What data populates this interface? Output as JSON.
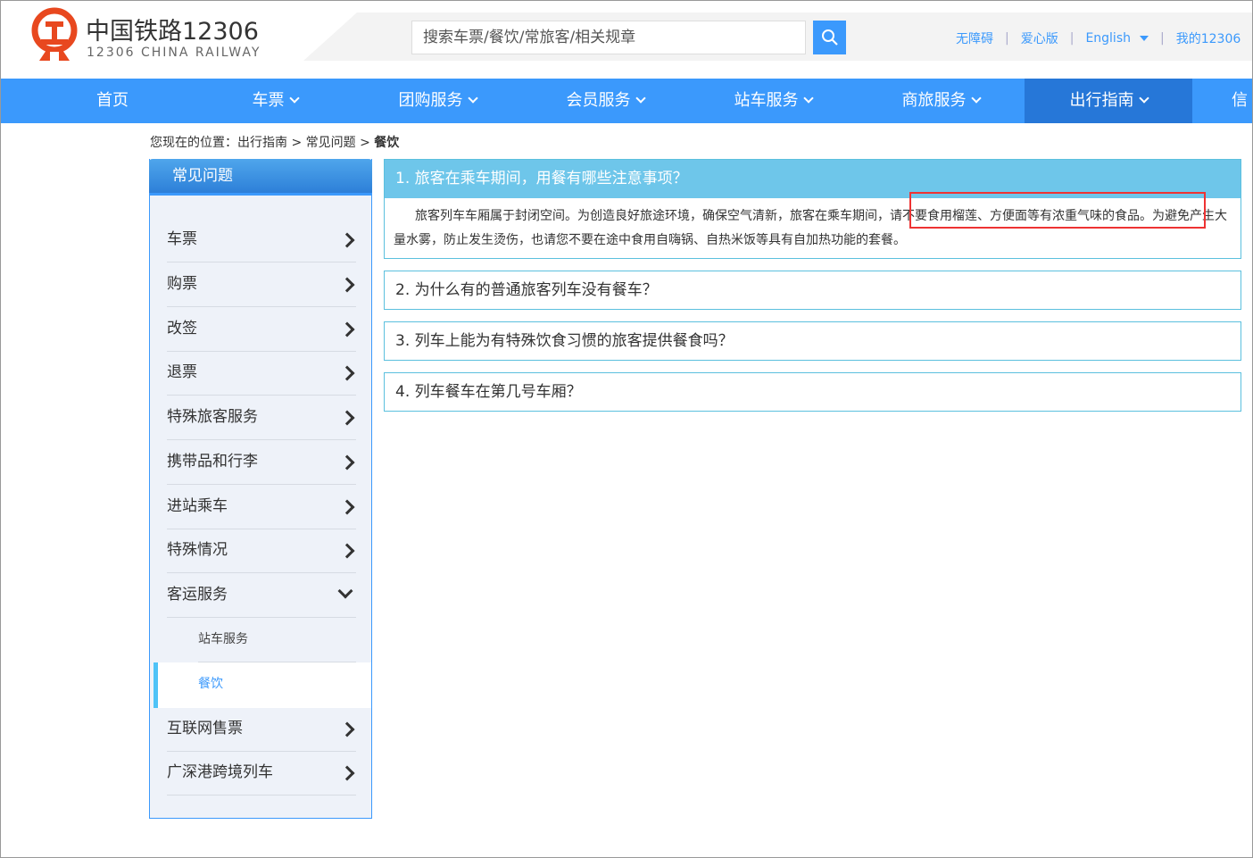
{
  "header": {
    "brand_cn": "中国铁路12306",
    "brand_en": "12306 CHINA RAILWAY",
    "search_placeholder": "搜索车票/餐饮/常旅客/相关规章",
    "logo_icon": "railway-logo-icon",
    "links": [
      "无障碍",
      "爱心版",
      "English",
      "我的12306"
    ]
  },
  "nav": {
    "items": [
      {
        "label": "首页"
      },
      {
        "label": "车票"
      },
      {
        "label": "团购服务"
      },
      {
        "label": "会员服务"
      },
      {
        "label": "站车服务"
      },
      {
        "label": "商旅服务"
      },
      {
        "label": "出行指南"
      },
      {
        "label": "信"
      }
    ],
    "active": "出行指南"
  },
  "breadcrumb": {
    "prefix": "您现在的位置：出行指南 > 常见问题 > ",
    "current": "餐饮"
  },
  "sidebar": {
    "title": "常见问题",
    "items": [
      {
        "label": "车票"
      },
      {
        "label": "购票"
      },
      {
        "label": "改签"
      },
      {
        "label": "退票"
      },
      {
        "label": "特殊旅客服务"
      },
      {
        "label": "携带品和行李"
      },
      {
        "label": "进站乘车"
      },
      {
        "label": "特殊情况"
      },
      {
        "label": "客运服务"
      },
      {
        "label": "互联网售票"
      },
      {
        "label": "广深港跨境列车"
      }
    ],
    "sub_items": [
      {
        "label": "站车服务"
      },
      {
        "label": "餐饮"
      }
    ]
  },
  "faq": [
    {
      "question": "1. 旅客在乘车期间，用餐有哪些注意事项？",
      "answer": "旅客列车车厢属于封闭空间。为创造良好旅途环境，确保空气清新，旅客在乘车期间，请不要食用榴莲、方便面等有浓重气味的食品。为避免产生大量水雾，防止发生烫伤，也请您不要在途中食用自嗨锅、自热米饭等具有自加热功能的套餐。"
    },
    {
      "question": "2. 为什么有的普通旅客列车没有餐车？"
    },
    {
      "question": "3. 列车上能为有特殊饮食习惯的旅客提供餐食吗？"
    },
    {
      "question": "4. 列车餐车在第几号车厢？"
    }
  ],
  "colors": {
    "primary": "#3b99fc",
    "nav_active": "#2677d8",
    "question_header": "#6ec6ea",
    "highlight_box": "#ee3333",
    "logo_red": "#e8481f"
  }
}
